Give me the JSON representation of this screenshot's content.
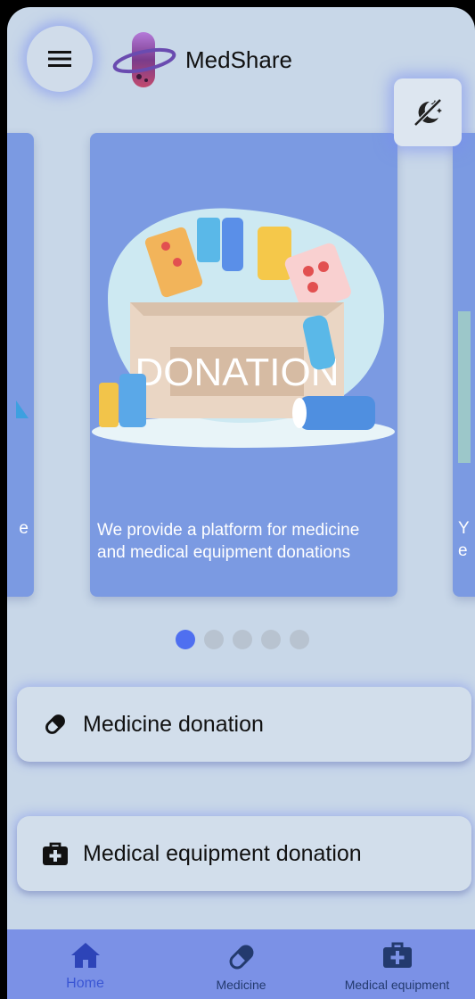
{
  "app": {
    "title": "MedShare"
  },
  "carousel": {
    "main_caption": "We provide a platform for medicine and medical equipment donations",
    "box_text": "DONATION",
    "left_edge_char": "e",
    "right_edge_chars": [
      "Y",
      "e"
    ],
    "slide_count": 5,
    "active_slide": 1
  },
  "actions": {
    "medicine": "Medicine donation",
    "equipment": "Medical equipment donation"
  },
  "nav": {
    "items": [
      {
        "label": "Home",
        "icon": "home-icon",
        "active": true
      },
      {
        "label": "Medicine",
        "icon": "pill-icon",
        "active": false
      },
      {
        "label": "Medical equipment",
        "icon": "medical-kit-icon",
        "active": false
      }
    ]
  },
  "colors": {
    "background": "#c8d7e8",
    "card": "#7b9ae2",
    "accent": "#4f6ff0",
    "nav": "#7b91e6"
  }
}
